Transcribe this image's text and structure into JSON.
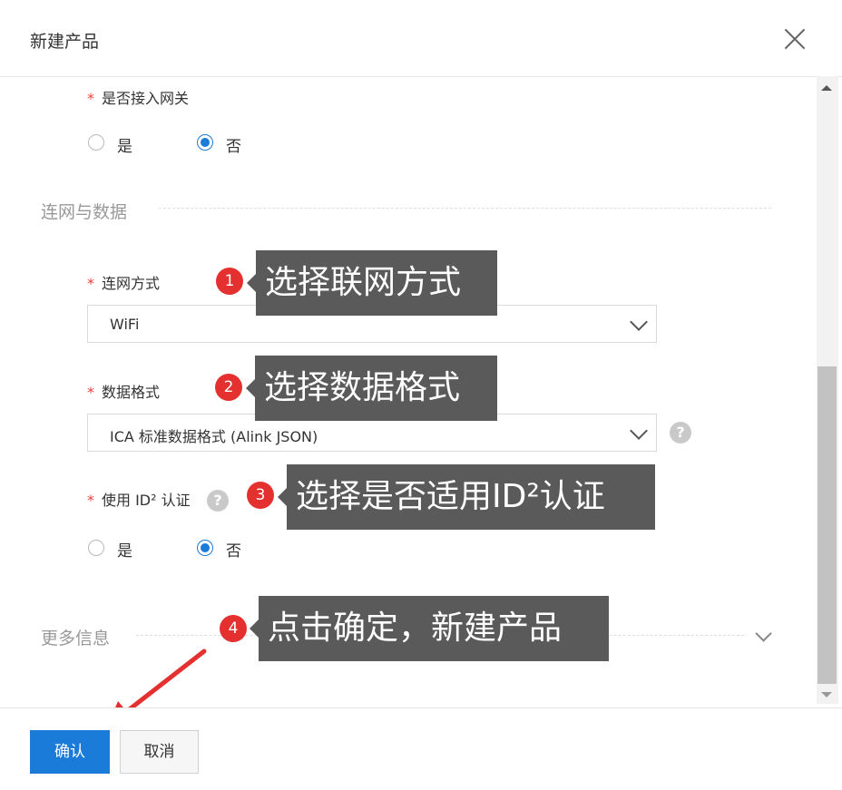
{
  "dialog": {
    "title": "新建产品"
  },
  "gateway": {
    "label": "是否接入网关",
    "options": [
      {
        "label": "是",
        "checked": false
      },
      {
        "label": "否",
        "checked": true
      }
    ]
  },
  "section_network": {
    "title": "连网与数据"
  },
  "network_method": {
    "label": "连网方式",
    "value": "WiFi"
  },
  "data_format": {
    "label": "数据格式",
    "value": "ICA 标准数据格式 (Alink JSON)"
  },
  "id2": {
    "label": "使用 ID² 认证",
    "options": [
      {
        "label": "是",
        "checked": false
      },
      {
        "label": "否",
        "checked": true
      }
    ]
  },
  "section_more": {
    "title": "更多信息"
  },
  "annotations": [
    {
      "number": "1",
      "text": "选择联网方式"
    },
    {
      "number": "2",
      "text": "选择数据格式"
    },
    {
      "number": "3",
      "text": "选择是否适用ID²认证"
    },
    {
      "number": "4",
      "text": "点击确定，新建产品"
    }
  ],
  "footer": {
    "confirm": "确认",
    "cancel": "取消"
  },
  "colors": {
    "primary": "#1b7bd8",
    "required_star": "#e64340",
    "badge": "#e4302f",
    "callout_bg": "#5a5a5a",
    "arrow": "#e4302f"
  },
  "icons": {
    "close": "close-icon",
    "help": "help-icon",
    "dropdown": "chevron-down-icon"
  }
}
